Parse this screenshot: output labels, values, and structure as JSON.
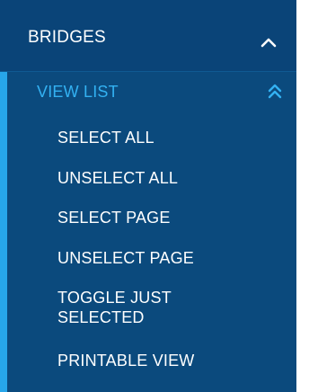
{
  "menu": {
    "section_title": "BRIDGES",
    "section_icon": "chevron-up-icon",
    "submenu": {
      "title": "VIEW LIST",
      "icon": "double-chevron-up-icon",
      "items": [
        "SELECT ALL",
        "UNSELECT ALL",
        "SELECT PAGE",
        "UNSELECT PAGE",
        "TOGGLE JUST SELECTED",
        "PRINTABLE VIEW"
      ]
    }
  },
  "colors": {
    "panel_background": "#0b4a7d",
    "accent": "#27a6ea",
    "active_text": "#33b1f2",
    "text": "#ffffff"
  }
}
